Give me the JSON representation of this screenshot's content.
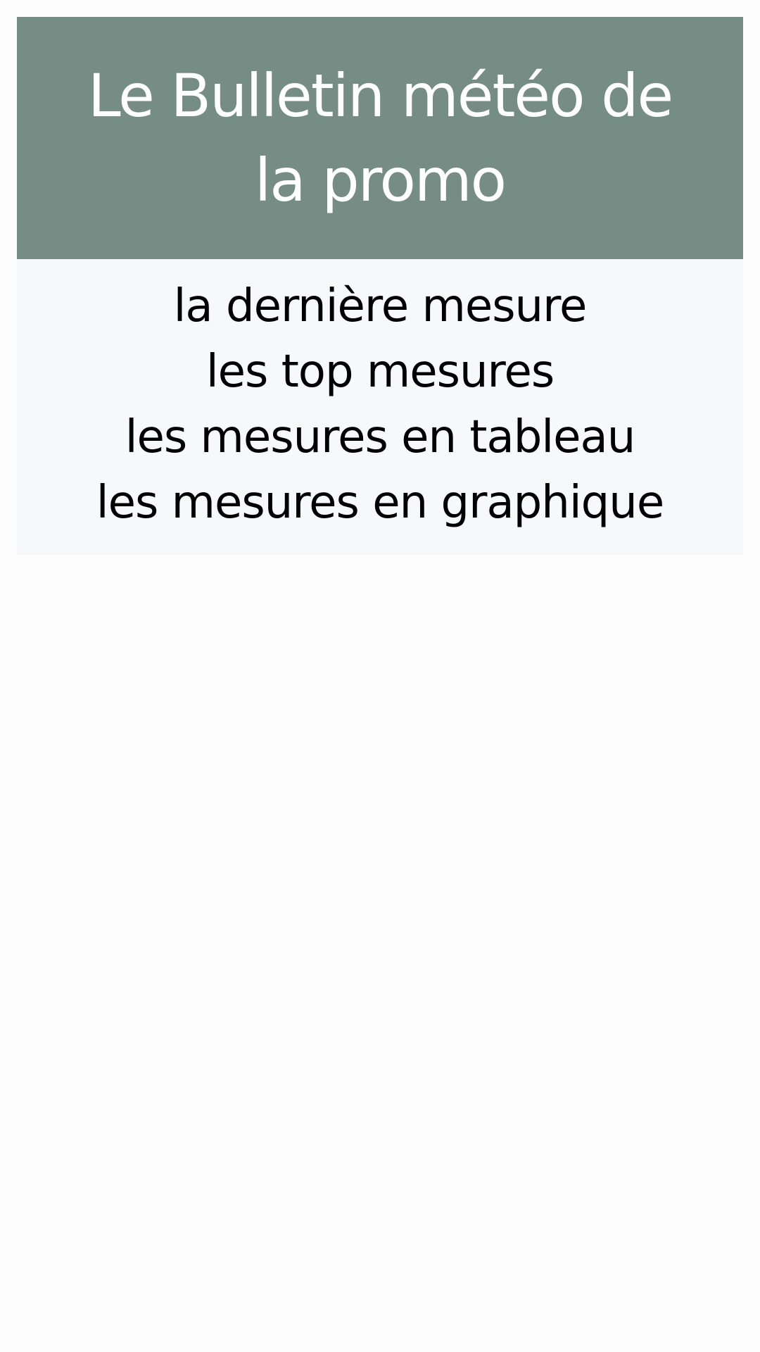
{
  "header": {
    "title": "Le Bulletin météo de la promo"
  },
  "nav": {
    "items": [
      {
        "label": "la dernière mesure"
      },
      {
        "label": "les top mesures"
      },
      {
        "label": "les mesures en tableau"
      },
      {
        "label": "les mesures en graphique"
      }
    ]
  },
  "colors": {
    "header_bg": "#768d86",
    "nav_bg": "#f7f8f9",
    "page_bg": "#fdfdfd",
    "header_text": "#ffffff",
    "nav_text": "#000000"
  }
}
